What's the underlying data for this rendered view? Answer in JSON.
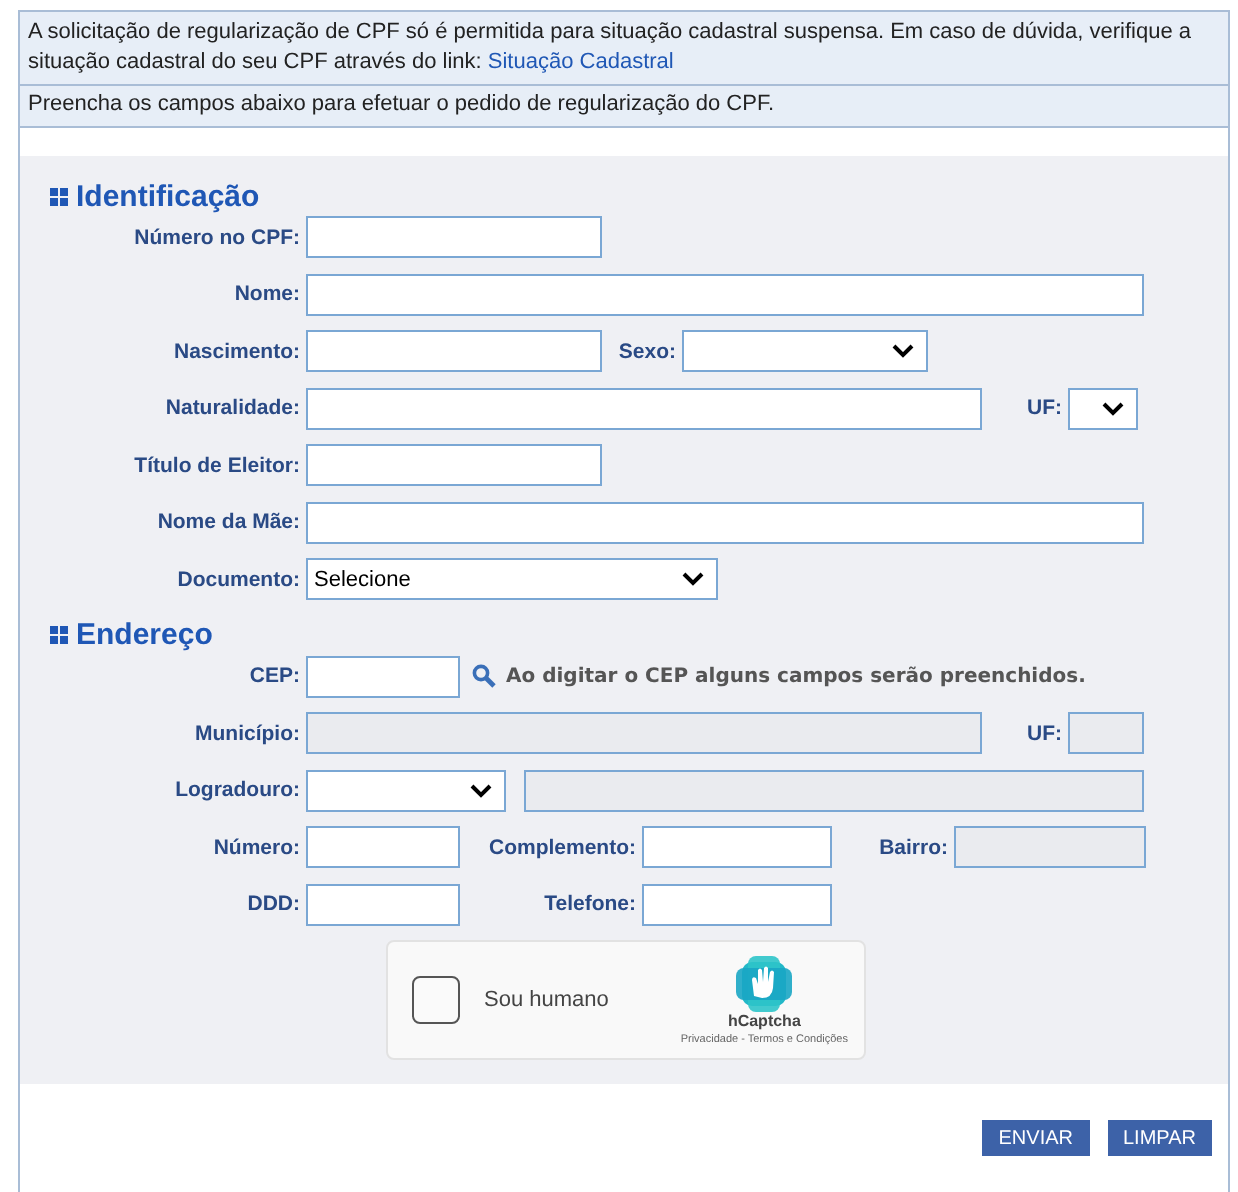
{
  "notice": {
    "text": "A solicitação de regularização de CPF só é permitida para situação cadastral suspensa. Em caso de dúvida, verifique a situação cadastral do seu CPF através do link:",
    "link": "Situação Cadastral"
  },
  "instructions": "Preencha os campos abaixo para efetuar o pedido de regularização do CPF.",
  "sections": [
    {
      "title": "Identificação",
      "rows": [
        {
          "fields": [
            {
              "label": "Número no CPF:",
              "kind": "text",
              "disabled": false
            }
          ]
        },
        {
          "fields": [
            {
              "label": "Nome:",
              "kind": "text",
              "disabled": false
            }
          ]
        },
        {
          "fields": [
            {
              "label": "Nascimento:",
              "kind": "text",
              "disabled": false
            },
            {
              "label": "Sexo:",
              "kind": "select",
              "disabled": false
            }
          ]
        },
        {
          "fields": [
            {
              "label": "Naturalidade:",
              "kind": "text",
              "disabled": false
            },
            {
              "label": "UF:",
              "kind": "select",
              "disabled": false
            }
          ]
        },
        {
          "fields": [
            {
              "label": "Título de Eleitor:",
              "kind": "text",
              "disabled": false
            }
          ]
        },
        {
          "fields": [
            {
              "label": "Nome da Mãe:",
              "kind": "text",
              "disabled": false
            }
          ]
        },
        {
          "fields": [
            {
              "label": "Documento:",
              "kind": "select",
              "value": "Selecione",
              "disabled": false
            }
          ]
        }
      ]
    },
    {
      "title": "Endereço",
      "rows": [
        {
          "fields": [
            {
              "label": "CEP:",
              "kind": "text",
              "disabled": false
            }
          ],
          "hint": "Ao digitar o CEP alguns campos serão preenchidos."
        },
        {
          "fields": [
            {
              "label": "Município:",
              "kind": "text",
              "disabled": true
            },
            {
              "label": "UF:",
              "kind": "text",
              "disabled": true
            }
          ]
        },
        {
          "fields": [
            {
              "label": "Logradouro:",
              "kind": "select",
              "disabled": false
            },
            {
              "kind": "text",
              "disabled": true
            }
          ]
        },
        {
          "fields": [
            {
              "label": "Número:",
              "kind": "text",
              "disabled": false
            },
            {
              "label": "Complemento:",
              "kind": "text",
              "disabled": false
            },
            {
              "label": "Bairro:",
              "kind": "text",
              "disabled": true
            }
          ]
        },
        {
          "fields": [
            {
              "label": "DDD:",
              "kind": "text",
              "disabled": false
            },
            {
              "label": "Telefone:",
              "kind": "text",
              "disabled": false
            }
          ]
        }
      ]
    }
  ],
  "captcha": {
    "label": "Sou humano",
    "checked": false,
    "brand": "hCaptcha",
    "footer": "Privacidade - Termos e Condições"
  },
  "buttons": [
    "ENVIAR",
    "LIMPAR"
  ]
}
